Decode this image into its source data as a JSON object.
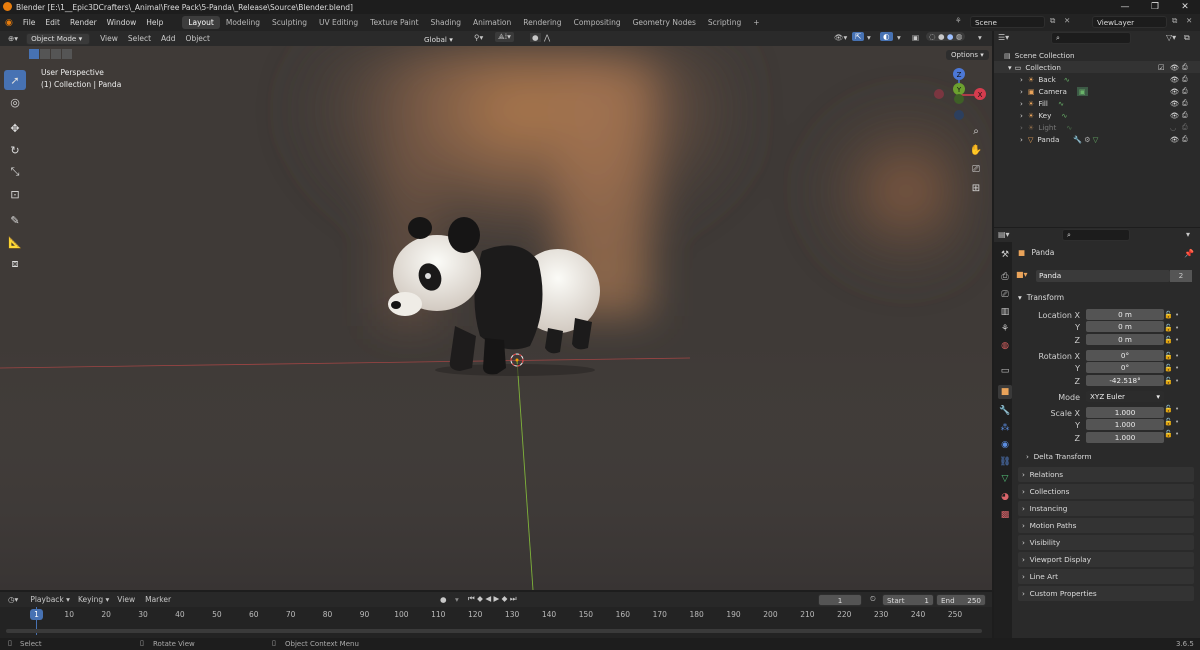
{
  "title_bar": {
    "title": "Blender [E:\\1__Epic3DCrafters\\_Animal\\Free Pack\\5-Panda\\_Release\\Source\\Blender.blend]"
  },
  "menus": [
    "File",
    "Edit",
    "Render",
    "Window",
    "Help"
  ],
  "workspaces": [
    "Layout",
    "Modeling",
    "Sculpting",
    "UV Editing",
    "Texture Paint",
    "Shading",
    "Animation",
    "Rendering",
    "Compositing",
    "Geometry Nodes",
    "Scripting"
  ],
  "active_workspace": "Layout",
  "scene": "Scene",
  "view_layer": "ViewLayer",
  "viewport": {
    "mode": "Object Mode",
    "menus": [
      "View",
      "Select",
      "Add",
      "Object"
    ],
    "transform_orientation": "Global",
    "overlay_title": "User Perspective",
    "overlay_subtitle": "(1) Collection | Panda",
    "options_label": "Options",
    "gizmo": {
      "x": "X",
      "y": "Y",
      "z": "Z"
    }
  },
  "outliner": {
    "root": "Scene Collection",
    "collection": "Collection",
    "items": [
      {
        "name": "Back"
      },
      {
        "name": "Camera"
      },
      {
        "name": "Fill"
      },
      {
        "name": "Key"
      },
      {
        "name": "Light"
      },
      {
        "name": "Panda"
      }
    ]
  },
  "properties": {
    "object_name": "Panda",
    "data_name": "Panda",
    "users": "2",
    "transform_header": "Transform",
    "location": {
      "label": "Location X",
      "x": "0 m",
      "y": "0 m",
      "z": "0 m"
    },
    "rotation": {
      "label": "Rotation X",
      "x": "0°",
      "y": "0°",
      "z": "-42.518°"
    },
    "mode_label": "Mode",
    "mode_value": "XYZ Euler",
    "scale": {
      "label": "Scale X",
      "x": "1.000",
      "y": "1.000",
      "z": "1.000"
    },
    "axis_labels": {
      "y": "Y",
      "z": "Z"
    },
    "delta_transform": "Delta Transform",
    "panels": [
      "Relations",
      "Collections",
      "Instancing",
      "Motion Paths",
      "Visibility",
      "Viewport Display",
      "Line Art",
      "Custom Properties"
    ]
  },
  "timeline": {
    "menus": [
      "Playback",
      "Keying",
      "View",
      "Marker"
    ],
    "current_frame": "1",
    "start_label": "Start",
    "start": "1",
    "end_label": "End",
    "end": "250",
    "ticks": [
      "1",
      "10",
      "20",
      "30",
      "40",
      "50",
      "60",
      "70",
      "80",
      "90",
      "100",
      "110",
      "120",
      "130",
      "140",
      "150",
      "160",
      "170",
      "180",
      "190",
      "200",
      "210",
      "220",
      "230",
      "240",
      "250"
    ]
  },
  "status_bar": {
    "select": "Select",
    "rotate": "Rotate View",
    "context": "Object Context Menu",
    "version": "3.6.5"
  }
}
